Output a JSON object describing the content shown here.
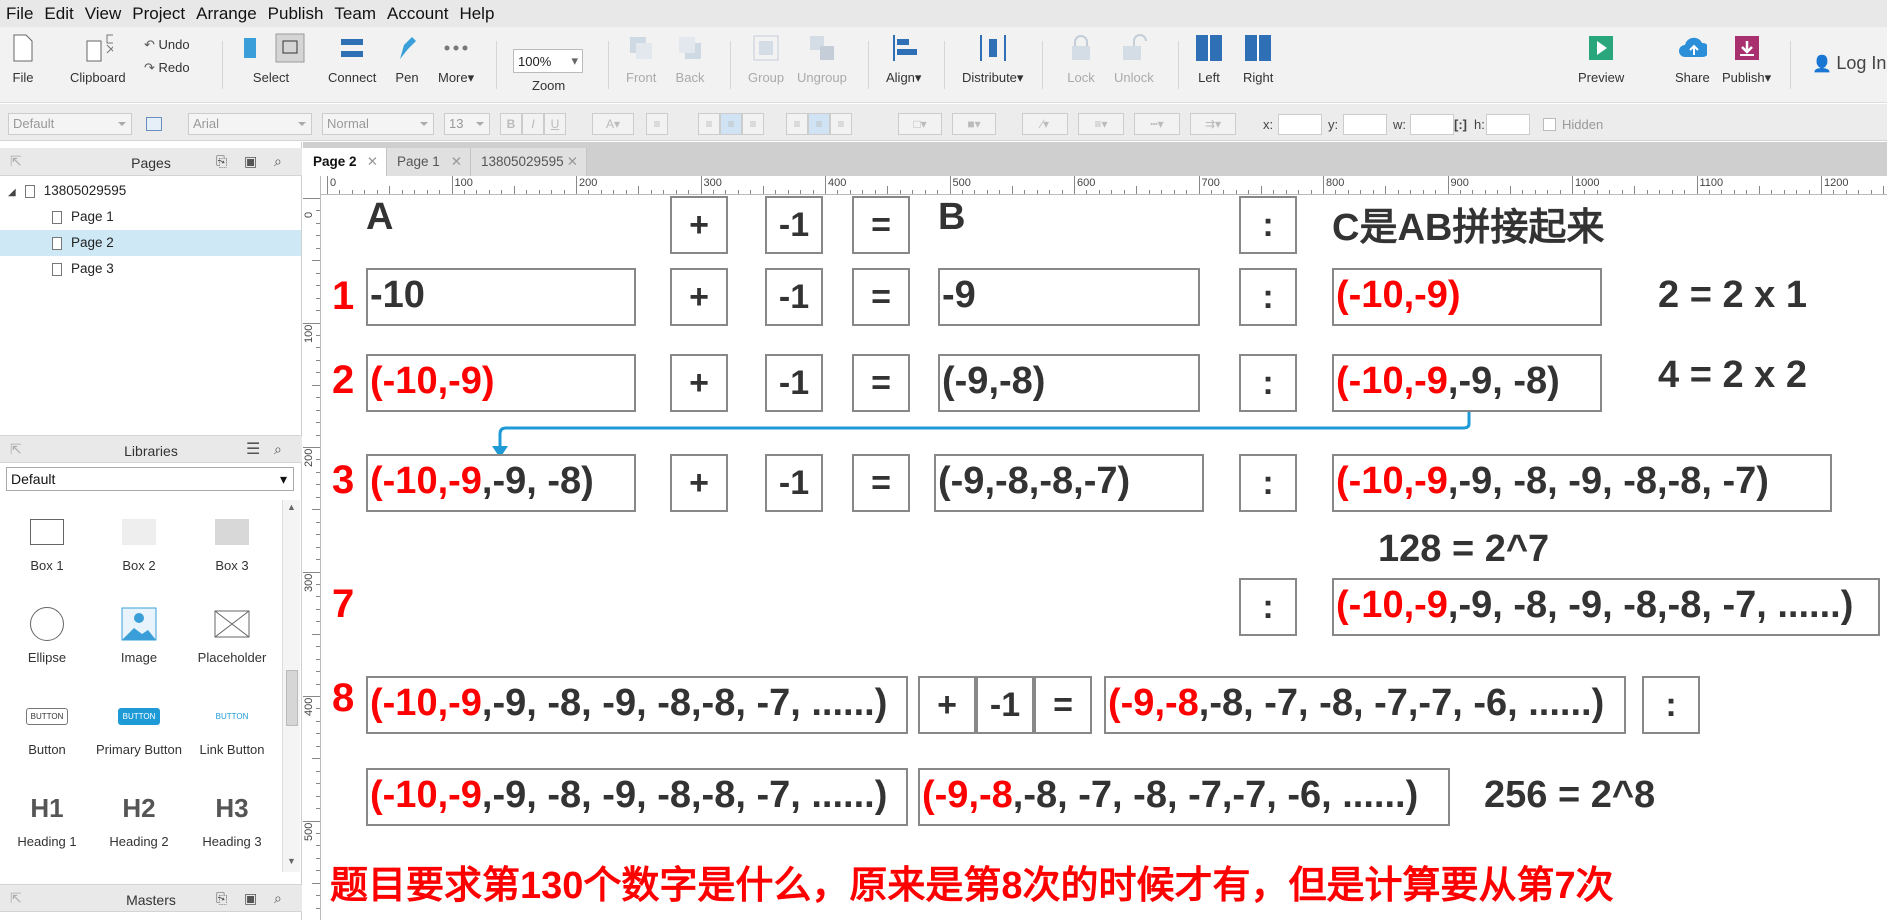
{
  "menu": [
    "File",
    "Edit",
    "View",
    "Project",
    "Arrange",
    "Publish",
    "Team",
    "Account",
    "Help"
  ],
  "toolbar": {
    "file": "File",
    "clipboard": "Clipboard",
    "undo": "Undo",
    "redo": "Redo",
    "select": "Select",
    "connect": "Connect",
    "pen": "Pen",
    "more": "More",
    "zoom_value": "100%",
    "zoom": "Zoom",
    "front": "Front",
    "back": "Back",
    "group": "Group",
    "ungroup": "Ungroup",
    "align": "Align",
    "distribute": "Distribute",
    "lock": "Lock",
    "unlock": "Unlock",
    "left": "Left",
    "right": "Right",
    "preview": "Preview",
    "share": "Share",
    "publish": "Publish",
    "login": "Log In"
  },
  "formatbar": {
    "style": "Default",
    "font": "Arial",
    "weight": "Normal",
    "size": "13",
    "x_label": "x:",
    "y_label": "y:",
    "w_label": "w:",
    "h_label": "h:",
    "hidden_label": "Hidden"
  },
  "pages_panel": {
    "title": "Pages",
    "root": "13805029595",
    "pages": [
      "Page 1",
      "Page 2",
      "Page 3"
    ]
  },
  "libraries_panel": {
    "title": "Libraries",
    "selected": "Default",
    "widgets": [
      "Box 1",
      "Box 2",
      "Box 3",
      "Ellipse",
      "Image",
      "Placeholder",
      "Button",
      "Primary Button",
      "Link Button",
      "Heading 1",
      "Heading 2",
      "Heading 3"
    ],
    "button_text": "BUTTON",
    "h1": "H1",
    "h2": "H2",
    "h3": "H3"
  },
  "masters_panel": {
    "title": "Masters"
  },
  "tabs": [
    "Page 2",
    "Page 1",
    "13805029595"
  ],
  "ruler": {
    "h": [
      "0",
      "100",
      "200",
      "300",
      "400",
      "500",
      "600",
      "700",
      "800",
      "900",
      "1000",
      "1100",
      "1200"
    ],
    "v": [
      "0",
      "100",
      "200",
      "300",
      "400",
      "500"
    ]
  },
  "canvas": {
    "hdr_a": "A",
    "hdr_b": "B",
    "hdr_c": "C是AB拼接起来",
    "plus": "+",
    "minus1": "-1",
    "eq": "=",
    "colon": ":",
    "rownums": [
      "1",
      "2",
      "3",
      "7",
      "8"
    ],
    "r1_a": "-10",
    "r1_b": "-9",
    "r1_c": "(-10,-9)",
    "r1_note": "2 = 2 x 1",
    "r2_a": "(-10,-9)",
    "r2_b": "(-9,-8)",
    "r2_c_red": "(-10,-9",
    "r2_c_rest": ",-9, -8)",
    "r2_note": "4 = 2 x 2",
    "r3_a_red": "(-10,-9",
    "r3_a_rest": ",-9, -8)",
    "r3_b": "(-9,-8,-8,-7)",
    "r3_c_red": "(-10,-9",
    "r3_c_rest": ",-9, -8, -9, -8,-8, -7)",
    "note_128": "128 =  2^7",
    "r7_c_red": "(-10,-9",
    "r7_c_rest": ",-9, -8, -9, -8,-8, -7, ......)",
    "r8_a_red": "(-10,-9",
    "r8_a_rest": ",-9, -8, -9, -8,-8, -7, ......)",
    "r8_b_red": "(-9,-8",
    "r8_b_rest": ",-8, -7, -8, -7,-7, -6, ......)",
    "r9_a_red": "(-10,-9",
    "r9_a_rest": ",-9, -8, -9, -8,-8, -7, ......)",
    "r9_b_red": "(-9,-8",
    "r9_b_rest": ",-8, -7, -8, -7,-7, -6, ......)",
    "note_256": "256 = 2^8",
    "bottom_text": "题目要求第130个数字是什么，原来是第8次的时候才有，但是计算要从第7次"
  }
}
